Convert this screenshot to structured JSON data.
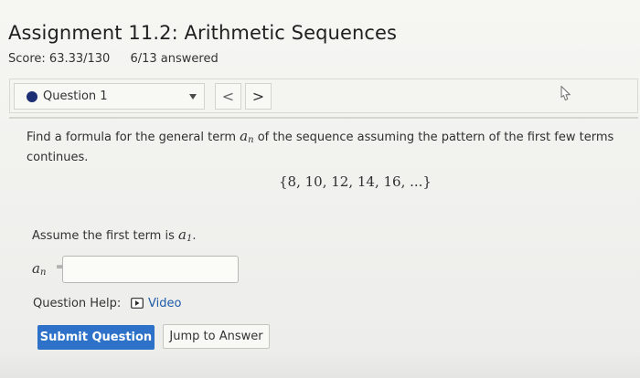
{
  "header": {
    "title": "Assignment 11.2: Arithmetic Sequences",
    "score": "Score: 63.33/130",
    "answered": "6/13 answered"
  },
  "question_nav": {
    "selected_question": "Question 1",
    "prev_label": "<",
    "next_label": ">",
    "icons": {
      "status": "status-dot-icon",
      "dropdown": "chevron-down-icon",
      "cursor": "pointer-cursor-icon"
    },
    "colors": {
      "status_dot": "#1d2f74"
    }
  },
  "problem": {
    "prompt_before": "Find a formula for the general term ",
    "term_symbol": "a",
    "term_subscript": "n",
    "prompt_after": " of the sequence assuming the pattern of the first few terms continues.",
    "sequence": "{8, 10, 12, 14, 16, ...}",
    "assume_before": "Assume the first term is ",
    "first_term_symbol": "a",
    "first_term_subscript": "1",
    "assume_after": "."
  },
  "answer": {
    "label_symbol": "a",
    "label_subscript": "n",
    "equals": "=",
    "value": "",
    "placeholder": ""
  },
  "help": {
    "label": "Question Help:",
    "video_label": "Video",
    "video_icon": "video-icon"
  },
  "actions": {
    "submit_label": "Submit Question",
    "jump_label": "Jump to Answer",
    "colors": {
      "submit_background": "#2d72c8"
    }
  }
}
